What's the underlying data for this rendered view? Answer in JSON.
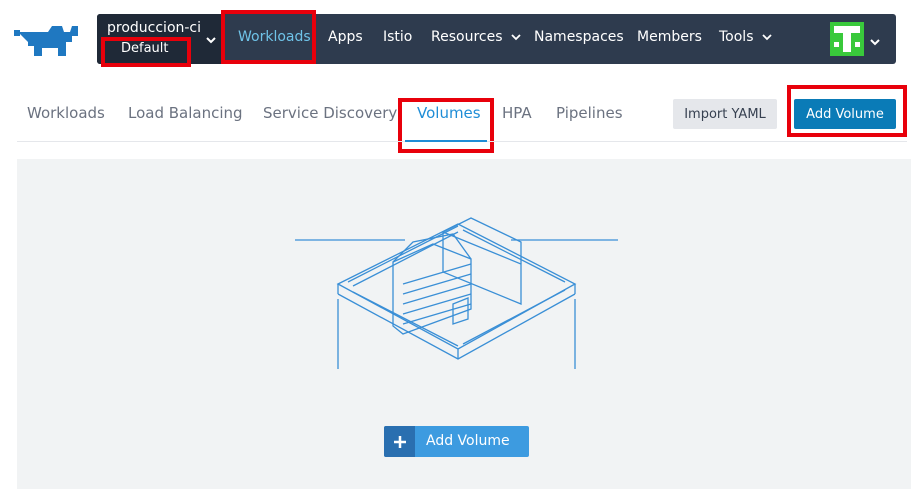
{
  "brand": {
    "logo_icon": "rancher-logo-icon"
  },
  "topbar": {
    "cluster_name": "produccion-ci",
    "project_name": "Default",
    "nav": [
      {
        "label": "Workloads",
        "active": true,
        "dropdown": false
      },
      {
        "label": "Apps",
        "active": false,
        "dropdown": false
      },
      {
        "label": "Istio",
        "active": false,
        "dropdown": false
      },
      {
        "label": "Resources",
        "active": false,
        "dropdown": true
      },
      {
        "label": "Namespaces",
        "active": false,
        "dropdown": false
      },
      {
        "label": "Members",
        "active": false,
        "dropdown": false
      },
      {
        "label": "Tools",
        "active": false,
        "dropdown": true
      }
    ]
  },
  "tabs": [
    {
      "label": "Workloads",
      "active": false
    },
    {
      "label": "Load Balancing",
      "active": false
    },
    {
      "label": "Service Discovery",
      "active": false
    },
    {
      "label": "Volumes",
      "active": true
    },
    {
      "label": "HPA",
      "active": false
    },
    {
      "label": "Pipelines",
      "active": false
    }
  ],
  "actions": {
    "import_label": "Import YAML",
    "add_label": "Add Volume"
  },
  "empty_state": {
    "button_label": "Add Volume",
    "illustration": "barn-illustration"
  },
  "colors": {
    "accent": "#1f8dd6",
    "topbar": "#2e3b4e",
    "highlight": "#e8000b",
    "primary_button": "#0a7bb7"
  }
}
